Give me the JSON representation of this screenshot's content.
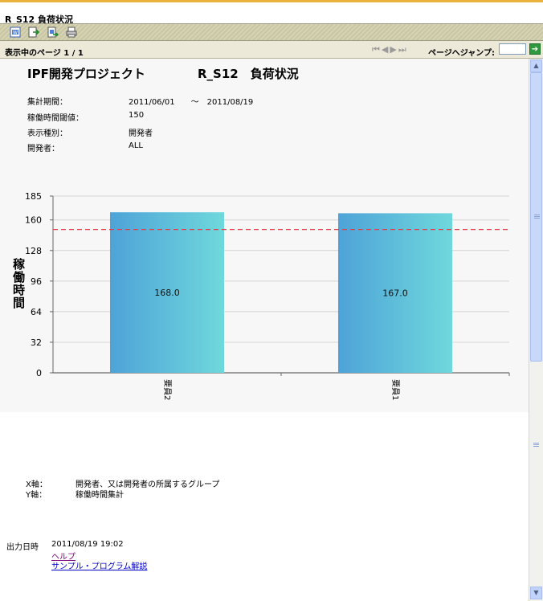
{
  "window": {
    "title": "R_S12  負荷状況"
  },
  "toolbar": {
    "icons": [
      "export-icon",
      "save-icon",
      "save-as-icon",
      "print-icon"
    ]
  },
  "nav": {
    "page_label": "表示中のページ",
    "page_current": "1",
    "page_sep": "/",
    "page_total": "1",
    "jump_label": "ページへジャンプ:",
    "jump_value": "",
    "go_glyph": "➔"
  },
  "report": {
    "project_title": "IPF開発プロジェクト",
    "report_title": "R_S12　負荷状況",
    "meta": [
      {
        "label": "集計期間：",
        "value": "2011/06/01　　～　2011/08/19"
      },
      {
        "label": "稼働時間閾値：",
        "value": "150"
      },
      {
        "label": "表示種別：",
        "value": "開発者"
      },
      {
        "label": "開発者：",
        "value": "ALL"
      }
    ],
    "y_axis_title": "稼働時間"
  },
  "chart_data": {
    "type": "bar",
    "categories": [
      "要員2",
      "要員1"
    ],
    "values": [
      168.0,
      167.0
    ],
    "value_labels": [
      "168.0",
      "167.0"
    ],
    "threshold": 150,
    "ylim": [
      0,
      185
    ],
    "yticks": [
      0,
      32,
      64,
      96,
      128,
      160,
      185
    ],
    "ylabel": "稼働時間",
    "xlabel": "",
    "bar_colors": [
      "#4ea3d8",
      "#6fd8dc"
    ],
    "threshold_color": "#e0404a",
    "grid": true
  },
  "legend": [
    {
      "label": "X軸：",
      "value": "開発者、又は開発者の所属するグループ"
    },
    {
      "label": "Y軸：",
      "value": "稼働時間集計"
    }
  ],
  "footer": {
    "output_label": "出力日時",
    "output_value": "2011/08/19 19:02",
    "help_link": "ヘルプ",
    "sample_link": "サンプル・プログラム解説"
  }
}
